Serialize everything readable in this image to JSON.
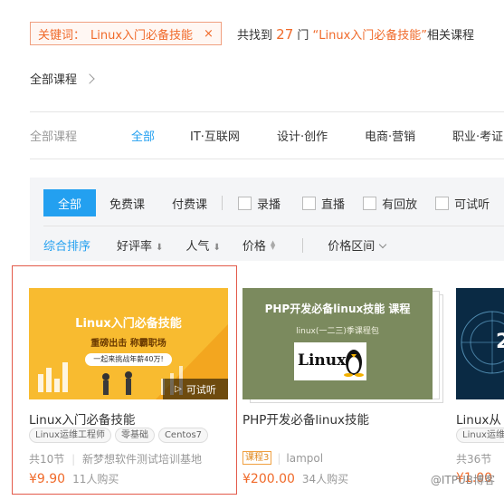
{
  "search": {
    "keyword_label": "关键词：",
    "keyword": "Linux入门必备技能",
    "close_glyph": "×",
    "found_prefix": "共找到",
    "found_count": "27",
    "found_mid": "门",
    "found_quote": "“Linux入门必备技能”",
    "found_suffix": "相关课程"
  },
  "breadcrumb": {
    "label": "全部课程"
  },
  "categories": {
    "label": "全部课程",
    "items": [
      "全部",
      "IT·互联网",
      "设计·创作",
      "电商·营销",
      "职业·考证"
    ],
    "active": "全部"
  },
  "filters": {
    "all": "全部",
    "free": "免费课",
    "paid": "付费课",
    "checkboxes": [
      "录播",
      "直播",
      "有回放",
      "可试听"
    ]
  },
  "sort": {
    "default": "综合排序",
    "rating": "好评率",
    "popularity": "人气",
    "price": "价格",
    "price_range": "价格区间"
  },
  "courses": [
    {
      "thumb_title": "Linux入门必备技能",
      "thumb_sub": "重磅出击  称霸职场",
      "thumb_banner": "一起来挑战年薪40万!",
      "preview": "可试听",
      "title": "Linux入门必备技能",
      "tags": [
        "Linux运维工程师",
        "零基础",
        "Centos7"
      ],
      "lessons": "共10节",
      "org": "新梦想软件测试培训基地",
      "price": "¥9.90",
      "buyers": "11人购买"
    },
    {
      "thumb_title": "PHP开发必备linux技能 课程",
      "thumb_sub": "linux(一二三)季课程包",
      "logo_text": "Linux",
      "title": "PHP开发必备linux技能",
      "badge": "课程3",
      "org": "lampol",
      "price": "¥200.00",
      "buyers": "34人购买"
    },
    {
      "title": "Linux从",
      "tags": [
        "Linux运维"
      ],
      "lessons": "共36节",
      "price": "¥1.00"
    }
  ],
  "watermark": "@ITPUB博客",
  "colors": {
    "accent": "#23a0f0",
    "price": "#f06a2a",
    "selection": "#e35a4a"
  }
}
